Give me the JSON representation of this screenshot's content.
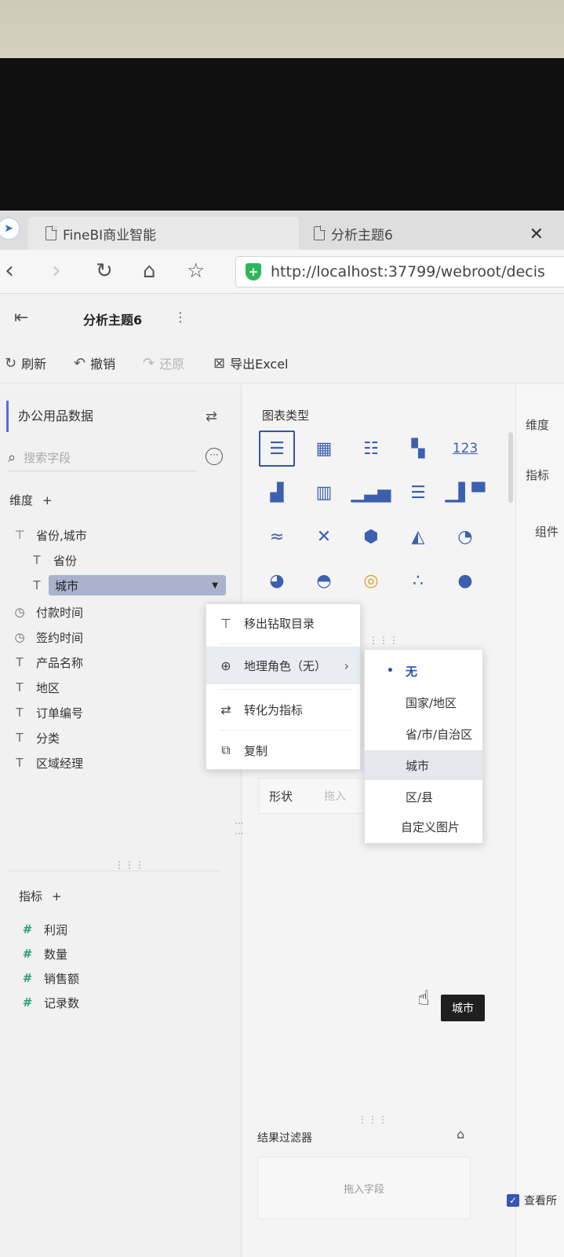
{
  "browser": {
    "tabs": [
      {
        "label": "FineBI商业智能"
      },
      {
        "label": "分析主题6"
      }
    ],
    "url": "http://localhost:37799/webroot/decis"
  },
  "app": {
    "title": "分析主题6"
  },
  "toolbar": {
    "refresh": "刷新",
    "undo": "撤销",
    "redo": "还原",
    "export": "导出Excel"
  },
  "data_panel": {
    "dataset": "办公用品数据",
    "search_placeholder": "搜索字段",
    "dimension_header": "维度",
    "dimensions": [
      {
        "type": "hierarchy",
        "name": "省份,城市"
      },
      {
        "type": "text",
        "name": "省份"
      },
      {
        "type": "text",
        "name": "城市"
      },
      {
        "type": "date",
        "name": "付款时间"
      },
      {
        "type": "date",
        "name": "签约时间"
      },
      {
        "type": "text",
        "name": "产品名称"
      },
      {
        "type": "text",
        "name": "地区"
      },
      {
        "type": "text",
        "name": "订单编号"
      },
      {
        "type": "text",
        "name": "分类"
      },
      {
        "type": "text",
        "name": "区域经理"
      }
    ],
    "measure_header": "指标",
    "measures": [
      {
        "name": "利润"
      },
      {
        "name": "数量"
      },
      {
        "name": "销售额"
      },
      {
        "name": "记录数"
      }
    ]
  },
  "chart_panel": {
    "title": "图表类型",
    "chart_icons": [
      "table-icon",
      "crosstab-icon",
      "detail-table-icon",
      "kpi-card-icon",
      "number-icon",
      "grouped-bar-icon",
      "stacked-bar-icon",
      "column-icon",
      "horizontal-bar-icon",
      "waterfall-icon",
      "line-icon",
      "radar-icon",
      "polygon-icon",
      "area-icon",
      "gauge-icon",
      "pie-icon",
      "rose-icon",
      "multi-pie-icon",
      "scatter-icon",
      "bubble-icon"
    ],
    "shape_label": "形状",
    "drop_hint": "拖入",
    "result_filter": "结果过滤器",
    "filter_drop_hint": "拖入字段"
  },
  "right_panel": {
    "dimension": "维度",
    "measure": "指标",
    "component": "组件",
    "view_all": "查看所"
  },
  "context_menu": {
    "items": [
      {
        "label": "移出钻取目录"
      },
      {
        "label": "地理角色（无）"
      },
      {
        "label": "转化为指标"
      },
      {
        "label": "复制"
      }
    ]
  },
  "geo_submenu": {
    "options": [
      "无",
      "国家/地区",
      "省/市/自治区",
      "城市",
      "区/县",
      "自定义图片"
    ],
    "selected": "无",
    "hovered": "城市"
  },
  "tooltip": "城市"
}
